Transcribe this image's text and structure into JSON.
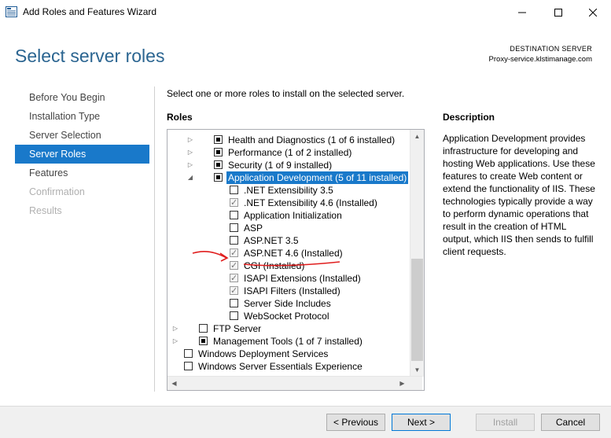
{
  "window": {
    "title": "Add Roles and Features Wizard",
    "minimize_icon": "minimize-icon",
    "maximize_icon": "maximize-icon",
    "close_icon": "close-icon"
  },
  "header": {
    "page_title": "Select server roles",
    "destination_label": "DESTINATION SERVER",
    "destination_server": "Proxy-service.klstimanage.com"
  },
  "steps": [
    {
      "label": "Before You Begin",
      "state": "normal"
    },
    {
      "label": "Installation Type",
      "state": "normal"
    },
    {
      "label": "Server Selection",
      "state": "normal"
    },
    {
      "label": "Server Roles",
      "state": "active"
    },
    {
      "label": "Features",
      "state": "normal"
    },
    {
      "label": "Confirmation",
      "state": "disabled"
    },
    {
      "label": "Results",
      "state": "disabled"
    }
  ],
  "main": {
    "instruction": "Select one or more roles to install on the selected server.",
    "roles_heading": "Roles",
    "roles": [
      {
        "label": "Health and Diagnostics (1 of 6 installed)",
        "level": 2,
        "arrow": "collapsed",
        "check": "partial"
      },
      {
        "label": "Performance (1 of 2 installed)",
        "level": 2,
        "arrow": "collapsed",
        "check": "partial"
      },
      {
        "label": "Security (1 of 9 installed)",
        "level": 2,
        "arrow": "collapsed",
        "check": "partial"
      },
      {
        "label": "Application Development (5 of 11 installed)",
        "level": 2,
        "arrow": "expanded",
        "check": "partial",
        "selected": true
      },
      {
        "label": ".NET Extensibility 3.5",
        "level": 3,
        "arrow": "none",
        "check": "unchecked"
      },
      {
        "label": ".NET Extensibility 4.6 (Installed)",
        "level": 3,
        "arrow": "none",
        "check": "checked-disabled"
      },
      {
        "label": "Application Initialization",
        "level": 3,
        "arrow": "none",
        "check": "unchecked"
      },
      {
        "label": "ASP",
        "level": 3,
        "arrow": "none",
        "check": "unchecked"
      },
      {
        "label": "ASP.NET 3.5",
        "level": 3,
        "arrow": "none",
        "check": "unchecked"
      },
      {
        "label": "ASP.NET 4.6 (Installed)",
        "level": 3,
        "arrow": "none",
        "check": "checked-disabled"
      },
      {
        "label": "CGI (Installed)",
        "level": 3,
        "arrow": "none",
        "check": "checked-disabled"
      },
      {
        "label": "ISAPI Extensions (Installed)",
        "level": 3,
        "arrow": "none",
        "check": "checked-disabled"
      },
      {
        "label": "ISAPI Filters (Installed)",
        "level": 3,
        "arrow": "none",
        "check": "checked-disabled"
      },
      {
        "label": "Server Side Includes",
        "level": 3,
        "arrow": "none",
        "check": "unchecked"
      },
      {
        "label": "WebSocket Protocol",
        "level": 3,
        "arrow": "none",
        "check": "unchecked"
      },
      {
        "label": "FTP Server",
        "level": 1,
        "arrow": "collapsed",
        "check": "unchecked"
      },
      {
        "label": "Management Tools (1 of 7 installed)",
        "level": 1,
        "arrow": "collapsed",
        "check": "partial"
      },
      {
        "label": "Windows Deployment Services",
        "level": 0,
        "arrow": "none",
        "check": "unchecked"
      },
      {
        "label": "Windows Server Essentials Experience",
        "level": 0,
        "arrow": "none",
        "check": "unchecked"
      }
    ]
  },
  "description": {
    "heading": "Description",
    "text": "Application Development provides infrastructure for developing and hosting Web applications. Use these features to create Web content or extend the functionality of IIS. These technologies typically provide a way to perform dynamic operations that result in the creation of HTML output, which IIS then sends to fulfill client requests."
  },
  "footer": {
    "previous": "< Previous",
    "next": "Next >",
    "install": "Install",
    "cancel": "Cancel"
  },
  "colors": {
    "accent": "#1979ca",
    "title_blue": "#2b6591",
    "annotation_red": "#e01e1e"
  }
}
